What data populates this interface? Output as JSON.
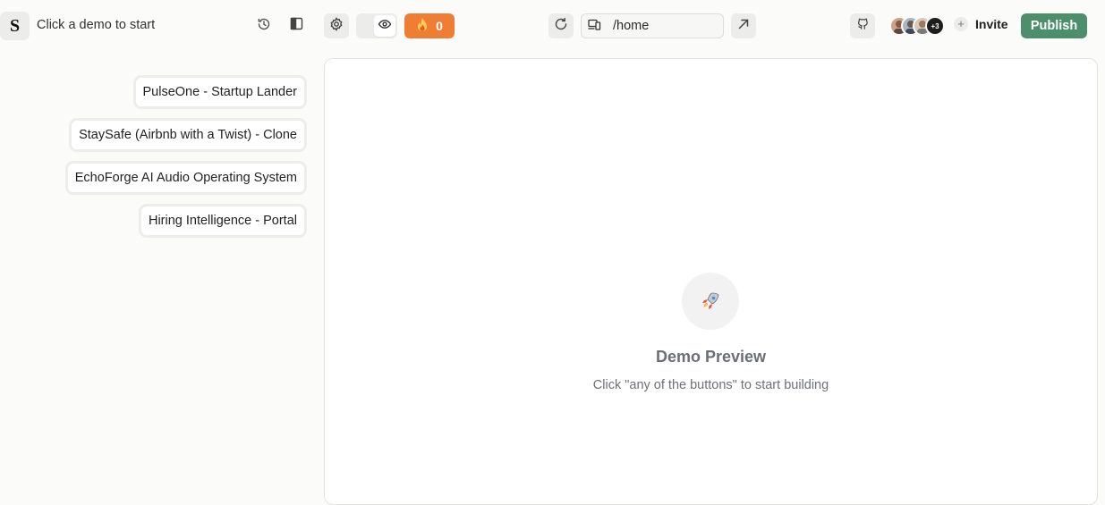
{
  "header": {
    "logo_letter": "S",
    "status_text": "Click a demo to start",
    "fire_count": "0",
    "url_path": "/home",
    "avatars_more": "+3",
    "invite_label": "Invite",
    "publish_label": "Publish"
  },
  "sidebar": {
    "demos": [
      {
        "label": "PulseOne - Startup Lander"
      },
      {
        "label": "StaySafe (Airbnb with a Twist) - Clone"
      },
      {
        "label": "EchoForge AI Audio Operating System"
      },
      {
        "label": "Hiring Intelligence - Portal"
      }
    ]
  },
  "preview": {
    "title": "Demo Preview",
    "subtitle": "Click \"any of the buttons\" to start building"
  },
  "colors": {
    "accent_fire": "#ef7d33",
    "publish_green": "#4d8f6d",
    "background": "#fbfbf9"
  },
  "icons": [
    "history-icon",
    "sidebar-toggle-icon",
    "settings-icon",
    "eye-icon",
    "fire-icon",
    "refresh-icon",
    "device-icon",
    "external-link-icon",
    "github-icon",
    "plus-icon",
    "rocket-icon"
  ]
}
